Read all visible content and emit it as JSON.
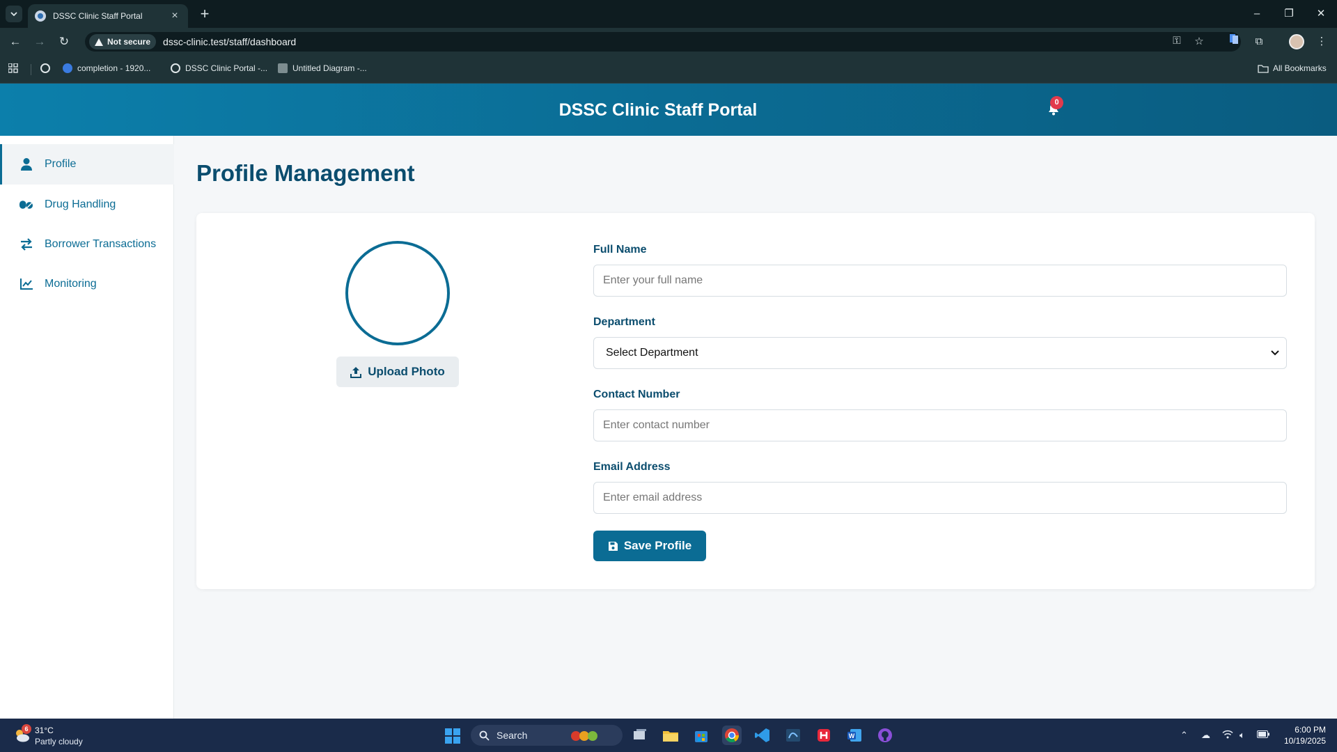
{
  "browser": {
    "tab_title": "DSSC Clinic Staff Portal",
    "security_label": "Not secure",
    "url": "dssc-clinic.test/staff/dashboard",
    "bookmarks": [
      {
        "label": "completion - 1920..."
      },
      {
        "label": "DSSC Clinic Portal -..."
      },
      {
        "label": "Untitled Diagram -..."
      }
    ],
    "all_bookmarks_label": "All Bookmarks"
  },
  "header": {
    "title": "DSSC Clinic Staff Portal",
    "notification_count": "0"
  },
  "sidebar": {
    "items": [
      {
        "label": "Profile",
        "icon": "user-icon",
        "active": true
      },
      {
        "label": "Drug Handling",
        "icon": "pills-icon",
        "active": false
      },
      {
        "label": "Borrower Transactions",
        "icon": "exchange-arrows-icon",
        "active": false
      },
      {
        "label": "Monitoring",
        "icon": "line-chart-icon",
        "active": false
      }
    ]
  },
  "main": {
    "page_title": "Profile Management",
    "upload_label": "Upload Photo",
    "form": {
      "full_name_label": "Full Name",
      "full_name_placeholder": "Enter your full name",
      "full_name_value": "",
      "department_label": "Department",
      "department_selected": "Select Department",
      "contact_label": "Contact Number",
      "contact_placeholder": "Enter contact number",
      "contact_value": "",
      "email_label": "Email Address",
      "email_placeholder": "Enter email address",
      "email_value": "",
      "save_label": "Save Profile"
    }
  },
  "taskbar": {
    "weather_temp": "31°C",
    "weather_condition": "Partly cloudy",
    "weather_badge": "6",
    "search_label": "Search",
    "time": "6:00 PM",
    "date": "10/19/2025"
  },
  "colors": {
    "primary": "#0b6c94",
    "header_gradient_start": "#0c7fab",
    "title_text": "#0b4d6e",
    "badge": "#e23a4c"
  }
}
